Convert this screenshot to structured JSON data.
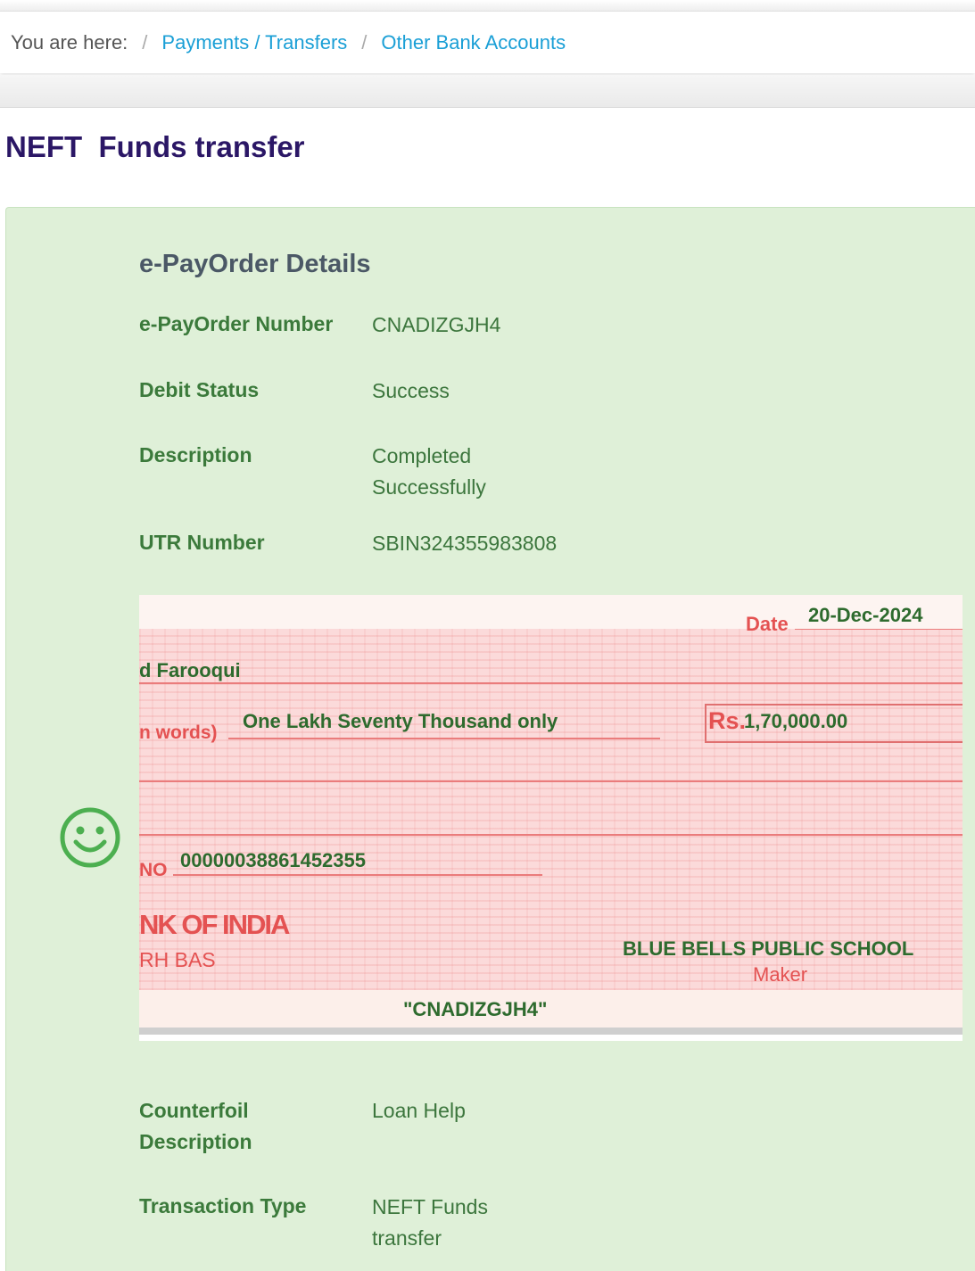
{
  "breadcrumb": {
    "prefix": "You are here:",
    "separator": "/",
    "items": [
      "Payments / Transfers",
      "Other Bank Accounts"
    ]
  },
  "page_title": "NEFT  Funds transfer",
  "section_title": "e-PayOrder Details",
  "details": [
    {
      "label": "e-PayOrder Number",
      "value": "CNADIZGJH4"
    },
    {
      "label": "Debit Status",
      "value": "Success"
    },
    {
      "label": "Description",
      "value": "Completed Successfully"
    },
    {
      "label": "UTR Number",
      "value": "SBIN324355983808"
    }
  ],
  "cheque": {
    "date_label": "Date",
    "date": "20-Dec-2024",
    "payee": "d Farooqui",
    "words_label": "n words)",
    "amount_words": "One Lakh Seventy Thousand only",
    "currency": "Rs.",
    "amount": "1,70,000.00",
    "account_label": "NO",
    "account_number": "00000038861452355",
    "bank_name": "NK OF INDIA",
    "branch": "RH BAS",
    "drawer": "BLUE BELLS PUBLIC SCHOOL",
    "maker_label": "Maker",
    "reference": "\"CNADIZGJH4\""
  },
  "details_after": [
    {
      "label": "Counterfoil Description",
      "value": "Loan Help"
    },
    {
      "label": "Transaction Type",
      "value": "NEFT Funds transfer"
    }
  ],
  "icons": {
    "status": "smiley-icon"
  },
  "colors": {
    "panel_bg": "#dff0d8",
    "label": "#3b7a3b",
    "value": "#3c763d",
    "title": "#2b1766",
    "link": "#1a9fd6",
    "cheque_red": "#e45252"
  }
}
